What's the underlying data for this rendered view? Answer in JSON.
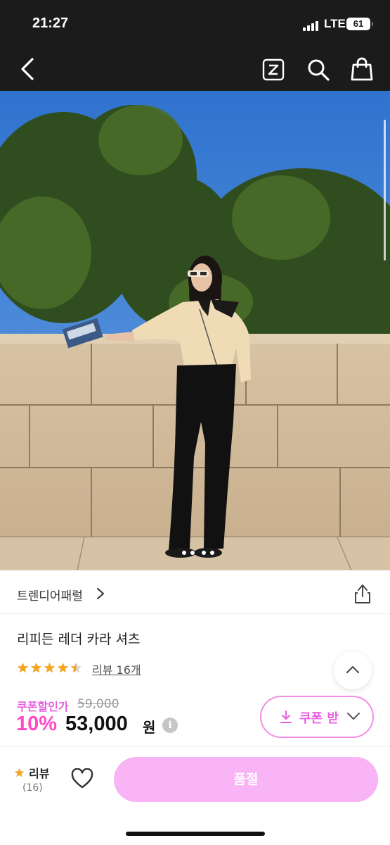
{
  "status_bar": {
    "time": "21:27",
    "network": "LTE",
    "battery": "61"
  },
  "nav": {
    "icons": [
      "back-icon",
      "zigzag-z-icon",
      "search-icon",
      "shopping-bag-icon"
    ]
  },
  "brand": {
    "name": "트렌디어패럴"
  },
  "product": {
    "title": "리피든 레더 카라 셔츠",
    "rating": 4.5,
    "rating_max": 5,
    "review_link": "리뷰 16개"
  },
  "price": {
    "coupon_label": "쿠폰할인가",
    "original": "59,000",
    "discount_rate": "10%",
    "sale": "53,000",
    "unit": "원"
  },
  "coupon_button": {
    "label": "쿠폰 받"
  },
  "bottom_bar": {
    "review_label": "리뷰",
    "review_count": "(16)",
    "soldout_label": "품절"
  },
  "colors": {
    "accent_pink": "#ff48c8",
    "soldout_button": "#f8b4f5",
    "star": "#f5a623",
    "topbar": "#1b1b1b"
  }
}
